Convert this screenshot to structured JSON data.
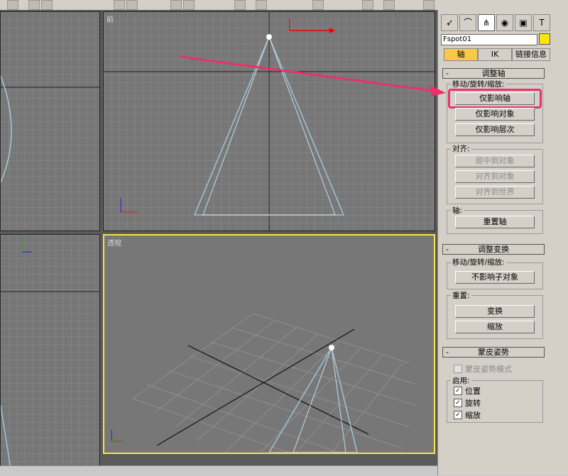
{
  "app": {
    "accent_colors": {
      "highlight": "#e8326c",
      "active_viewport": "#f5e34a",
      "object_color": "#ffe600",
      "active_tab": "#f6c94a"
    }
  },
  "toolbar": {
    "icons": [
      "magnet-icon",
      "rotate-icon",
      "undo-icon",
      "curve-icon",
      "arrow-icon",
      "select-icon",
      "paint-icon",
      "abc-icon",
      "link-icon",
      "zoom-icon",
      "material-icon",
      "render-icon",
      "scene-icon"
    ]
  },
  "viewports": {
    "top_left": {
      "label": ""
    },
    "front": {
      "label": "前"
    },
    "left": {
      "label": ""
    },
    "perspective": {
      "label": "透视"
    }
  },
  "command_panel": {
    "tabs": [
      {
        "icon": "pointer-icon"
      },
      {
        "icon": "curve-modify-icon"
      },
      {
        "icon": "hierarchy-icon"
      },
      {
        "icon": "motion-icon"
      },
      {
        "icon": "display-icon"
      },
      {
        "icon": "utilities-icon"
      }
    ],
    "object_name": "Fspot01",
    "subtabs": [
      "轴",
      "IK",
      "链接信息"
    ],
    "rollout_adjust_pivot": {
      "title": "调整轴",
      "move_rotate_scale_label": "移动/旋转/缩放:",
      "buttons": [
        "仅影响轴",
        "仅影响对象",
        "仅影响层次"
      ],
      "alignment_label": "对齐:",
      "align_buttons": [
        "居中到对象",
        "对齐到对象",
        "对齐到世界"
      ],
      "pivot_label": "轴:",
      "reset_pivot": "重置轴"
    },
    "rollout_adjust_transform": {
      "title": "调整变换",
      "move_rotate_scale_label": "移动/旋转/缩放:",
      "dont_affect_children": "不影响子对象",
      "reset_label": "重置:",
      "transform": "变换",
      "scale": "缩放"
    },
    "rollout_skin_pose": {
      "title": "蒙皮姿势",
      "skin_pose_mode": "蒙皮姿势模式",
      "enable_label": "启用:",
      "position": "位置",
      "rotation": "旋转",
      "scale": "缩放"
    }
  }
}
